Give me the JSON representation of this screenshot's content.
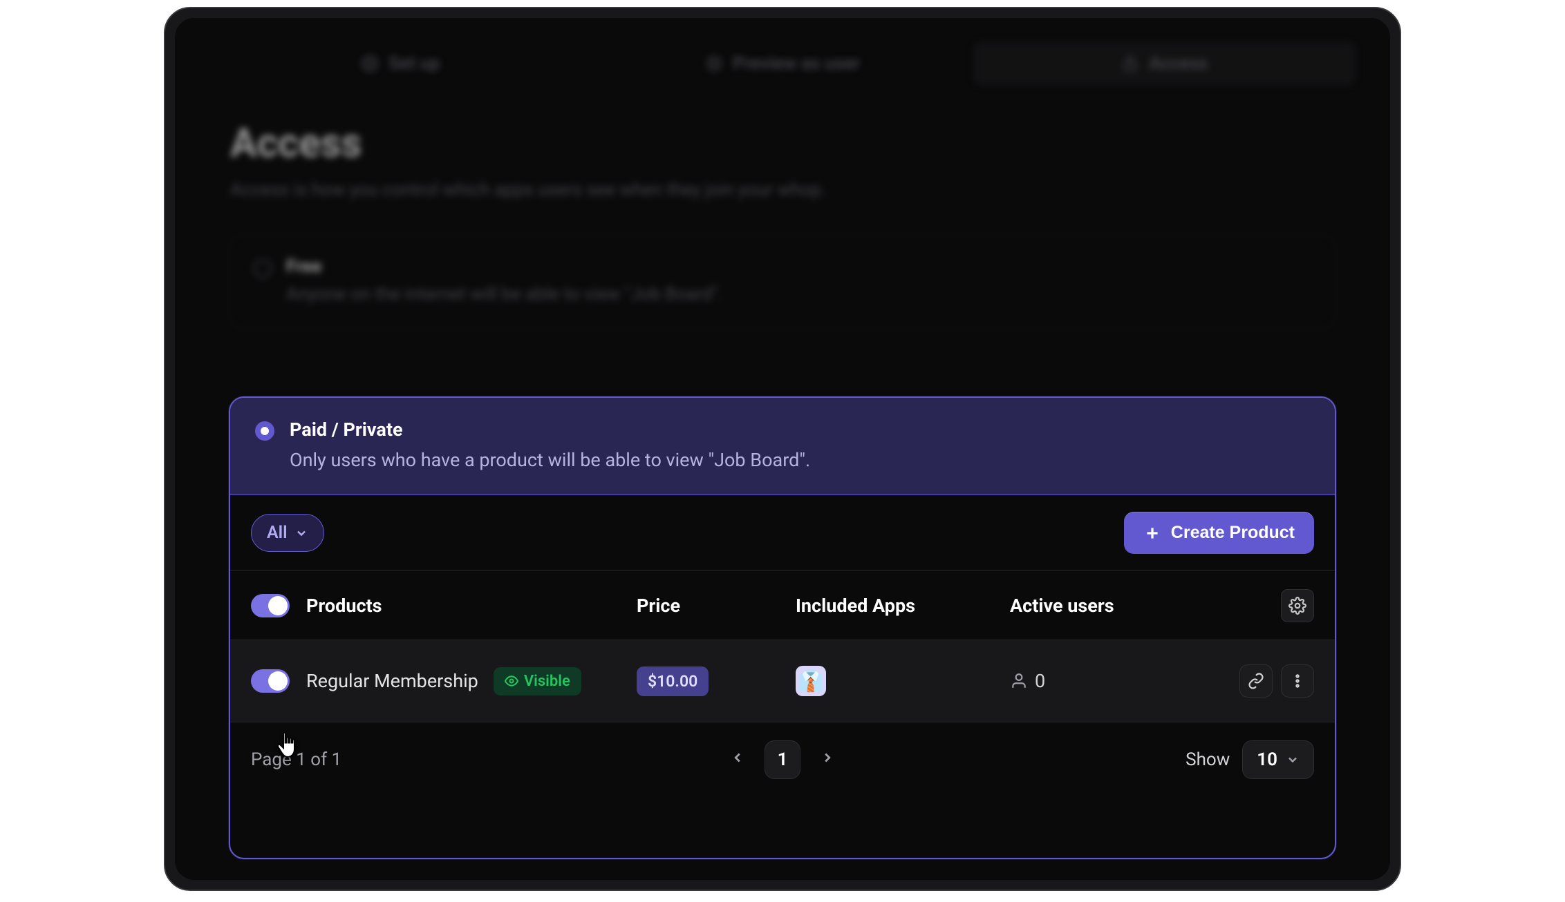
{
  "tabs": {
    "setup": "Set up",
    "preview": "Preview as user",
    "access": "Access"
  },
  "hero": {
    "title": "Access",
    "subtitle": "Access is how you control which apps users see when they join your whop."
  },
  "options": {
    "free": {
      "title": "Free",
      "desc": "Anyone on the internet will be able to view \"Job Board\"."
    },
    "paid": {
      "title": "Paid / Private",
      "desc": "Only users who have a product will be able to view \"Job Board\"."
    }
  },
  "toolbar": {
    "filter_label": "All",
    "create_label": "Create Product"
  },
  "table": {
    "headers": {
      "products": "Products",
      "price": "Price",
      "apps": "Included Apps",
      "users": "Active users"
    },
    "rows": [
      {
        "name": "Regular Membership",
        "visibility": "Visible",
        "price": "$10.00",
        "app_emoji": "👔",
        "active_users": "0"
      }
    ]
  },
  "pager": {
    "summary": "Page 1 of 1",
    "current": "1",
    "show_label": "Show",
    "show_value": "10"
  }
}
